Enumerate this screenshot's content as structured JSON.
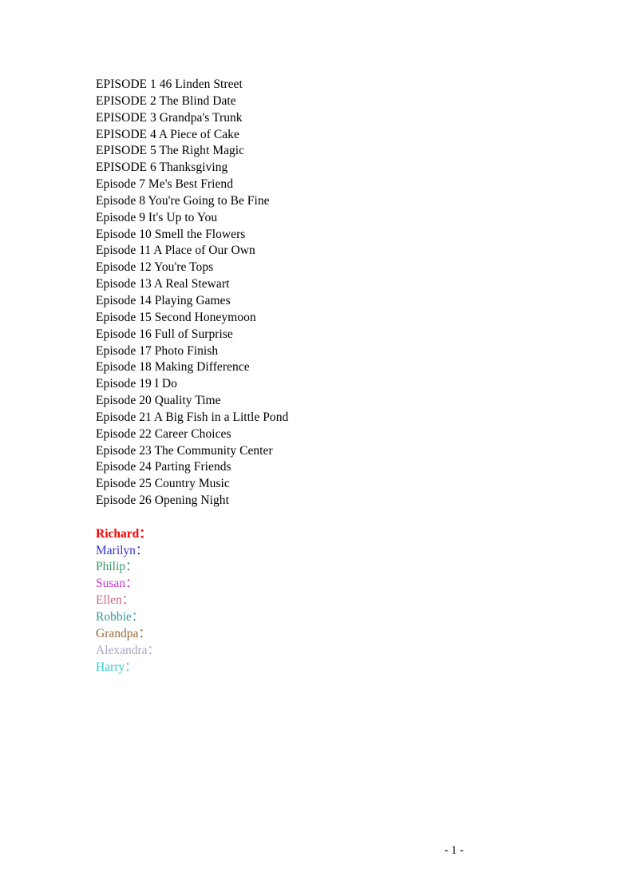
{
  "document": {
    "background_color": "#ffffff",
    "text_color": "#000000"
  },
  "episodes": [
    {
      "text": "EPISODE 1 46 Linden Street"
    },
    {
      "text": "EPISODE 2 The Blind Date"
    },
    {
      "text": "EPISODE 3 Grandpa's Trunk"
    },
    {
      "text": "EPISODE 4 A Piece of Cake"
    },
    {
      "text": "EPISODE 5 The Right Magic"
    },
    {
      "text": "EPISODE 6 Thanksgiving"
    },
    {
      "text": "Episode 7 Me's Best Friend"
    },
    {
      "text": "Episode 8 You're Going to Be Fine"
    },
    {
      "text": "Episode 9 It's Up to You"
    },
    {
      "text": "Episode 10 Smell the Flowers"
    },
    {
      "text": "Episode 11 A Place of Our Own"
    },
    {
      "text": "Episode 12 You're Tops"
    },
    {
      "text": "Episode 13 A Real Stewart"
    },
    {
      "text": "Episode 14 Playing Games"
    },
    {
      "text": "Episode 15 Second Honeymoon"
    },
    {
      "text": "Episode 16 Full of Surprise"
    },
    {
      "text": "Episode 17 Photo Finish"
    },
    {
      "text": "Episode 18 Making Difference"
    },
    {
      "text": "Episode 19 I Do"
    },
    {
      "text": "Episode 20 Quality Time"
    },
    {
      "text": "Episode 21 A Big Fish in a Little Pond"
    },
    {
      "text": "Episode 22 Career Choices"
    },
    {
      "text": "Episode 23 The Community Center"
    },
    {
      "text": "Episode 24 Parting Friends"
    },
    {
      "text": "Episode 25 Country Music"
    },
    {
      "text": "Episode 26 Opening Night"
    }
  ],
  "characters": [
    {
      "text": "Richard：",
      "color": "#ff0000",
      "bold": true
    },
    {
      "text": "Marilyn：",
      "color": "#3333cc",
      "bold": false
    },
    {
      "text": "Philip：",
      "color": "#339966",
      "bold": false
    },
    {
      "text": "Susan：",
      "color": "#cc33cc",
      "bold": false
    },
    {
      "text": "Ellen：",
      "color": "#cc6688",
      "bold": false
    },
    {
      "text": "Robbie：",
      "color": "#339999",
      "bold": false
    },
    {
      "text": "Grandpa：",
      "color": "#996633",
      "bold": false
    },
    {
      "text": "Alexandra：",
      "color": "#aaa5c0",
      "bold": false
    },
    {
      "text": "Harry：",
      "color": "#33cccc",
      "bold": false
    }
  ],
  "footer": {
    "page_marker": "- 1 -"
  }
}
